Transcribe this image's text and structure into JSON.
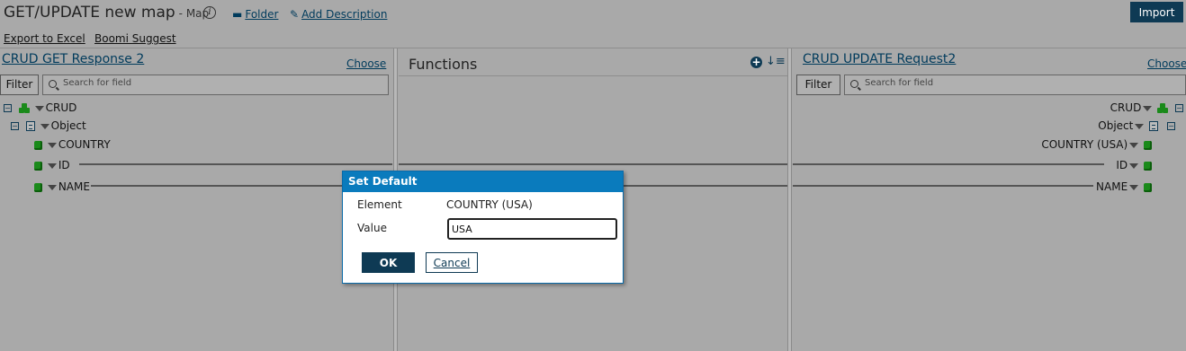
{
  "header": {
    "title": "GET/UPDATE new map",
    "subtitle": "- Map",
    "info_icon": "info-icon",
    "folder_label": "Folder",
    "add_description_label": "Add Description",
    "import_label": "Import",
    "export_label": "Export to Excel",
    "suggest_label": "Boomi Suggest"
  },
  "left_panel": {
    "title": "CRUD GET Response 2",
    "choose_label": "Choose",
    "filter_label": "Filter",
    "search_placeholder": "Search for field",
    "tree": {
      "root": "CRUD",
      "object": "Object",
      "fields": [
        "COUNTRY",
        "ID",
        "NAME"
      ]
    }
  },
  "functions_panel": {
    "title": "Functions"
  },
  "right_panel": {
    "title": "CRUD UPDATE Request2",
    "choose_label": "Choose",
    "filter_label": "Filter",
    "search_placeholder": "Search for field",
    "tree": {
      "root": "CRUD",
      "object": "Object",
      "fields": [
        "COUNTRY (USA)",
        "ID",
        "NAME"
      ]
    }
  },
  "dialog": {
    "title": "Set Default",
    "element_label": "Element",
    "element_value": "COUNTRY (USA)",
    "value_label": "Value",
    "value_input": "USA",
    "ok_label": "OK",
    "cancel_label": "Cancel"
  },
  "colors": {
    "accent_dark": "#0e3a54",
    "dialog_header": "#0a7bbd",
    "link": "#003b5c",
    "field_icon": "#1a8a1a"
  }
}
